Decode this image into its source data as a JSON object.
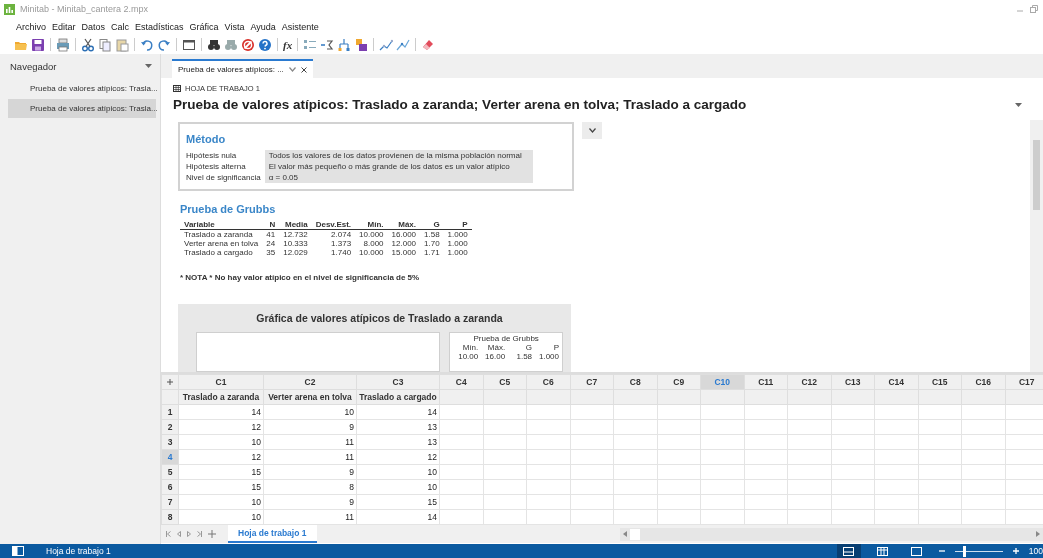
{
  "window": {
    "title": "Minitab - Minitab_cantera 2.mpx"
  },
  "menu": [
    "Archivo",
    "Editar",
    "Datos",
    "Calc",
    "Estadísticas",
    "Gráfica",
    "Vista",
    "Ayuda",
    "Asistente"
  ],
  "toolbar": {
    "formula_label": "fx"
  },
  "navigator": {
    "title": "Navegador",
    "items": [
      {
        "label": "Prueba de valores atípicos: Trasla...",
        "selected": false
      },
      {
        "label": "Prueba de valores atípicos: Trasla...",
        "selected": true
      }
    ]
  },
  "output_tab": {
    "label": "Prueba de valores atípicos: ..."
  },
  "report": {
    "worksheet": "HOJA DE TRABAJO 1",
    "title": "Prueba de valores atípicos: Traslado a zaranda; Verter arena en tolva; Traslado a cargado",
    "method": {
      "heading": "Método",
      "rows": [
        {
          "label": "Hipótesis nula",
          "value": "Todos los valores de los datos provienen de la misma población normal"
        },
        {
          "label": "Hipótesis alterna",
          "value": "El valor más pequeño o más grande de los datos es un valor atípico"
        },
        {
          "label": "Nivel de significancia",
          "value": "α = 0.05"
        }
      ]
    },
    "grubbs": {
      "heading": "Prueba de Grubbs",
      "columns": [
        "Variable",
        "N",
        "Media",
        "Desv.Est.",
        "Mín.",
        "Máx.",
        "G",
        "P"
      ],
      "rows": [
        [
          "Traslado a zaranda",
          "41",
          "12.732",
          "2.074",
          "10.000",
          "16.000",
          "1.58",
          "1.000"
        ],
        [
          "Verter arena en tolva",
          "24",
          "10.333",
          "1.373",
          "8.000",
          "12.000",
          "1.70",
          "1.000"
        ],
        [
          "Traslado a cargado",
          "35",
          "12.029",
          "1.740",
          "10.000",
          "15.000",
          "1.71",
          "1.000"
        ]
      ]
    },
    "note": "* NOTA * No hay valor atípico en el nivel de significancia de 5%",
    "chart": {
      "title": "Gráfica de valores atípicos de Traslado a zaranda",
      "legend": {
        "title": "Prueba de Grubbs",
        "columns": [
          "Mín.",
          "Máx.",
          "G",
          "P"
        ],
        "values": [
          "10.00",
          "16.00",
          "1.58",
          "1.000"
        ]
      }
    }
  },
  "worksheet": {
    "columns": [
      {
        "label": "C1",
        "name": "Traslado a zaranda",
        "selected": false
      },
      {
        "label": "C2",
        "name": "Verter arena en tolva",
        "selected": false
      },
      {
        "label": "C3",
        "name": "Traslado a cargado",
        "selected": false
      },
      {
        "label": "C4",
        "selected": false
      },
      {
        "label": "C5",
        "selected": false
      },
      {
        "label": "C6",
        "selected": false
      },
      {
        "label": "C7",
        "selected": false
      },
      {
        "label": "C8",
        "selected": false
      },
      {
        "label": "C9",
        "selected": false
      },
      {
        "label": "C10",
        "selected": true
      },
      {
        "label": "C11",
        "selected": false
      },
      {
        "label": "C12",
        "selected": false
      },
      {
        "label": "C13",
        "selected": false
      },
      {
        "label": "C14",
        "selected": false
      },
      {
        "label": "C15",
        "selected": false
      },
      {
        "label": "C16",
        "selected": false
      },
      {
        "label": "C17",
        "selected": false
      }
    ],
    "rows": [
      {
        "number": "1",
        "selected": false,
        "cells": [
          "14",
          "10",
          "14"
        ]
      },
      {
        "number": "2",
        "selected": false,
        "cells": [
          "12",
          "9",
          "13"
        ]
      },
      {
        "number": "3",
        "selected": false,
        "cells": [
          "10",
          "11",
          "13"
        ]
      },
      {
        "number": "4",
        "selected": true,
        "cells": [
          "12",
          "11",
          "12"
        ]
      },
      {
        "number": "5",
        "selected": false,
        "cells": [
          "15",
          "9",
          "10"
        ]
      },
      {
        "number": "6",
        "selected": false,
        "cells": [
          "15",
          "8",
          "10"
        ]
      },
      {
        "number": "7",
        "selected": false,
        "cells": [
          "10",
          "9",
          "15"
        ]
      },
      {
        "number": "8",
        "selected": false,
        "cells": [
          "10",
          "11",
          "14"
        ]
      }
    ]
  },
  "sheet_tabs": [
    {
      "label": "Hoja de trabajo 1",
      "selected": true
    }
  ],
  "status_bar": {
    "text": "Hoja de trabajo 1",
    "zoom": {
      "level": 0.2,
      "reading": "100"
    }
  }
}
